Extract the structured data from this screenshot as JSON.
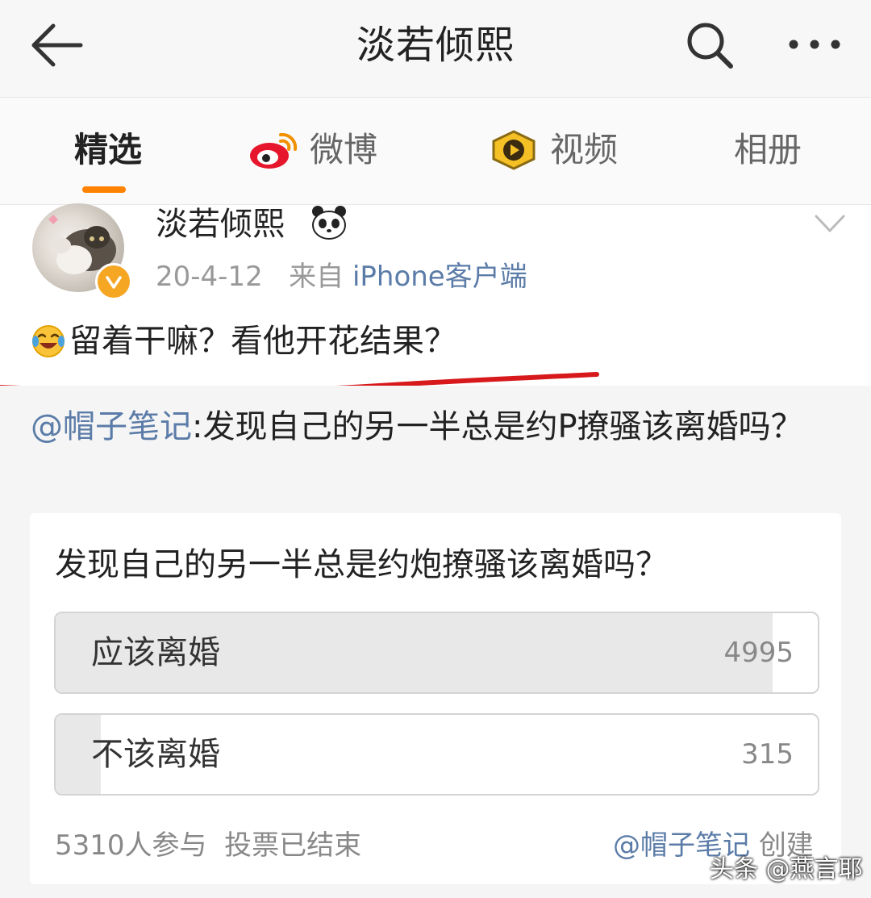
{
  "header": {
    "title": "淡若倾熙",
    "back_icon": "back-arrow-icon",
    "search_icon": "search-icon",
    "more_icon": "more-dots-icon"
  },
  "tabs": [
    {
      "label": "精选",
      "active": true
    },
    {
      "label": "微博",
      "icon": "weibo-logo-icon"
    },
    {
      "label": "视频",
      "icon": "video-badge-icon"
    },
    {
      "label": "相册"
    }
  ],
  "post": {
    "author": "淡若倾熙",
    "date": "20-4-12",
    "from_prefix": "来自",
    "source": "iPhone客户端",
    "text": "留着干嘛？看他开花结果？"
  },
  "repost": {
    "mention": "@帽子笔记",
    "text": ":发现自己的另一半总是约P撩骚该离婚吗？"
  },
  "poll": {
    "question": "发现自己的另一半总是约炮撩骚该离婚吗？",
    "options": [
      {
        "label": "应该离婚",
        "count": "4995",
        "share": 0.941
      },
      {
        "label": "不该离婚",
        "count": "315",
        "share": 0.059
      }
    ],
    "participants": "5310人参与",
    "status": "投票已结束",
    "creator_mention": "@帽子笔记",
    "creator_suffix": "创建"
  },
  "watermark": "头条 @燕言耶",
  "colors": {
    "accent": "#ff8200",
    "link": "#5b7ca8",
    "underline_red": "#d7191c"
  }
}
